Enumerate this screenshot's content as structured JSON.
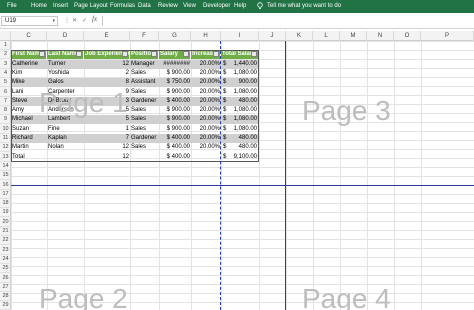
{
  "ribbon": {
    "tabs": [
      "File",
      "Home",
      "Insert",
      "Page Layout",
      "Formulas",
      "Data",
      "Review",
      "View",
      "Developer",
      "Help"
    ],
    "tell_me": "Tell me what you want to do",
    "bg": "#217346"
  },
  "formula_bar": {
    "name_box": "U19",
    "cancel": "✕",
    "enter": "✓",
    "fx": "fx",
    "value": ""
  },
  "columns": [
    "C",
    "D",
    "E",
    "F",
    "G",
    "H",
    "I",
    "J",
    "K",
    "L",
    "M",
    "N",
    "O",
    "P"
  ],
  "rows": [
    "1",
    "2",
    "3",
    "4",
    "5",
    "6",
    "7",
    "8",
    "9",
    "10",
    "11",
    "12",
    "13",
    "14",
    "15",
    "16",
    "17",
    "18",
    "19",
    "20",
    "21",
    "22",
    "23",
    "24",
    "25",
    "26",
    "27",
    "28",
    "29"
  ],
  "table": {
    "headers": [
      "First Name",
      "Last Name",
      "Job Experience",
      "Position",
      "Salary",
      "Increase",
      "Total Salary"
    ],
    "rows": [
      [
        "Catherine",
        "Turner",
        "12",
        "Manager",
        "########",
        "20.00%",
        "$",
        "1,440.00"
      ],
      [
        "Kim",
        "Yoshida",
        "2",
        "Sales",
        "$ 900.00",
        "20.00%",
        "$",
        "1,080.00"
      ],
      [
        "Mike",
        "Galos",
        "8",
        "Assistant",
        "$ 750.00",
        "20.00%",
        "$",
        "900.00"
      ],
      [
        "Lani",
        "Carpenter",
        "9",
        "Sales",
        "$ 900.00",
        "20.00%",
        "$",
        "1,080.00"
      ],
      [
        "Steve",
        "DeBroux",
        "3",
        "Gardener",
        "$ 400.00",
        "20.00%",
        "$",
        "480.00"
      ],
      [
        "Amy",
        "Anderson",
        "5",
        "Sales",
        "$ 900.00",
        "20.00%",
        "$",
        "1,080.00"
      ],
      [
        "Michael",
        "Lambert",
        "5",
        "Sales",
        "$ 900.00",
        "20.00%",
        "$",
        "1,080.00"
      ],
      [
        "Suzan",
        "Fine",
        "1",
        "Sales",
        "$ 900.00",
        "20.00%",
        "$",
        "1,080.00"
      ],
      [
        "Richard",
        "Kaplan",
        "7",
        "Gardener",
        "$ 400.00",
        "20.00%",
        "$",
        "480.00"
      ],
      [
        "Martin",
        "Nolan",
        "12",
        "Sales",
        "$ 400.00",
        "20.00%",
        "$",
        "480.00"
      ]
    ],
    "total_row": [
      "Total",
      "",
      "12",
      "",
      "$ 400.00",
      "",
      "$",
      "9,100.00"
    ]
  },
  "page_labels": [
    "Page 1",
    "Page 3",
    "Page 2",
    "Page 4"
  ],
  "colors": {
    "header_green": "#70ad47",
    "page_break": "#1f3fb4",
    "watermark": "#bdbdbd"
  }
}
